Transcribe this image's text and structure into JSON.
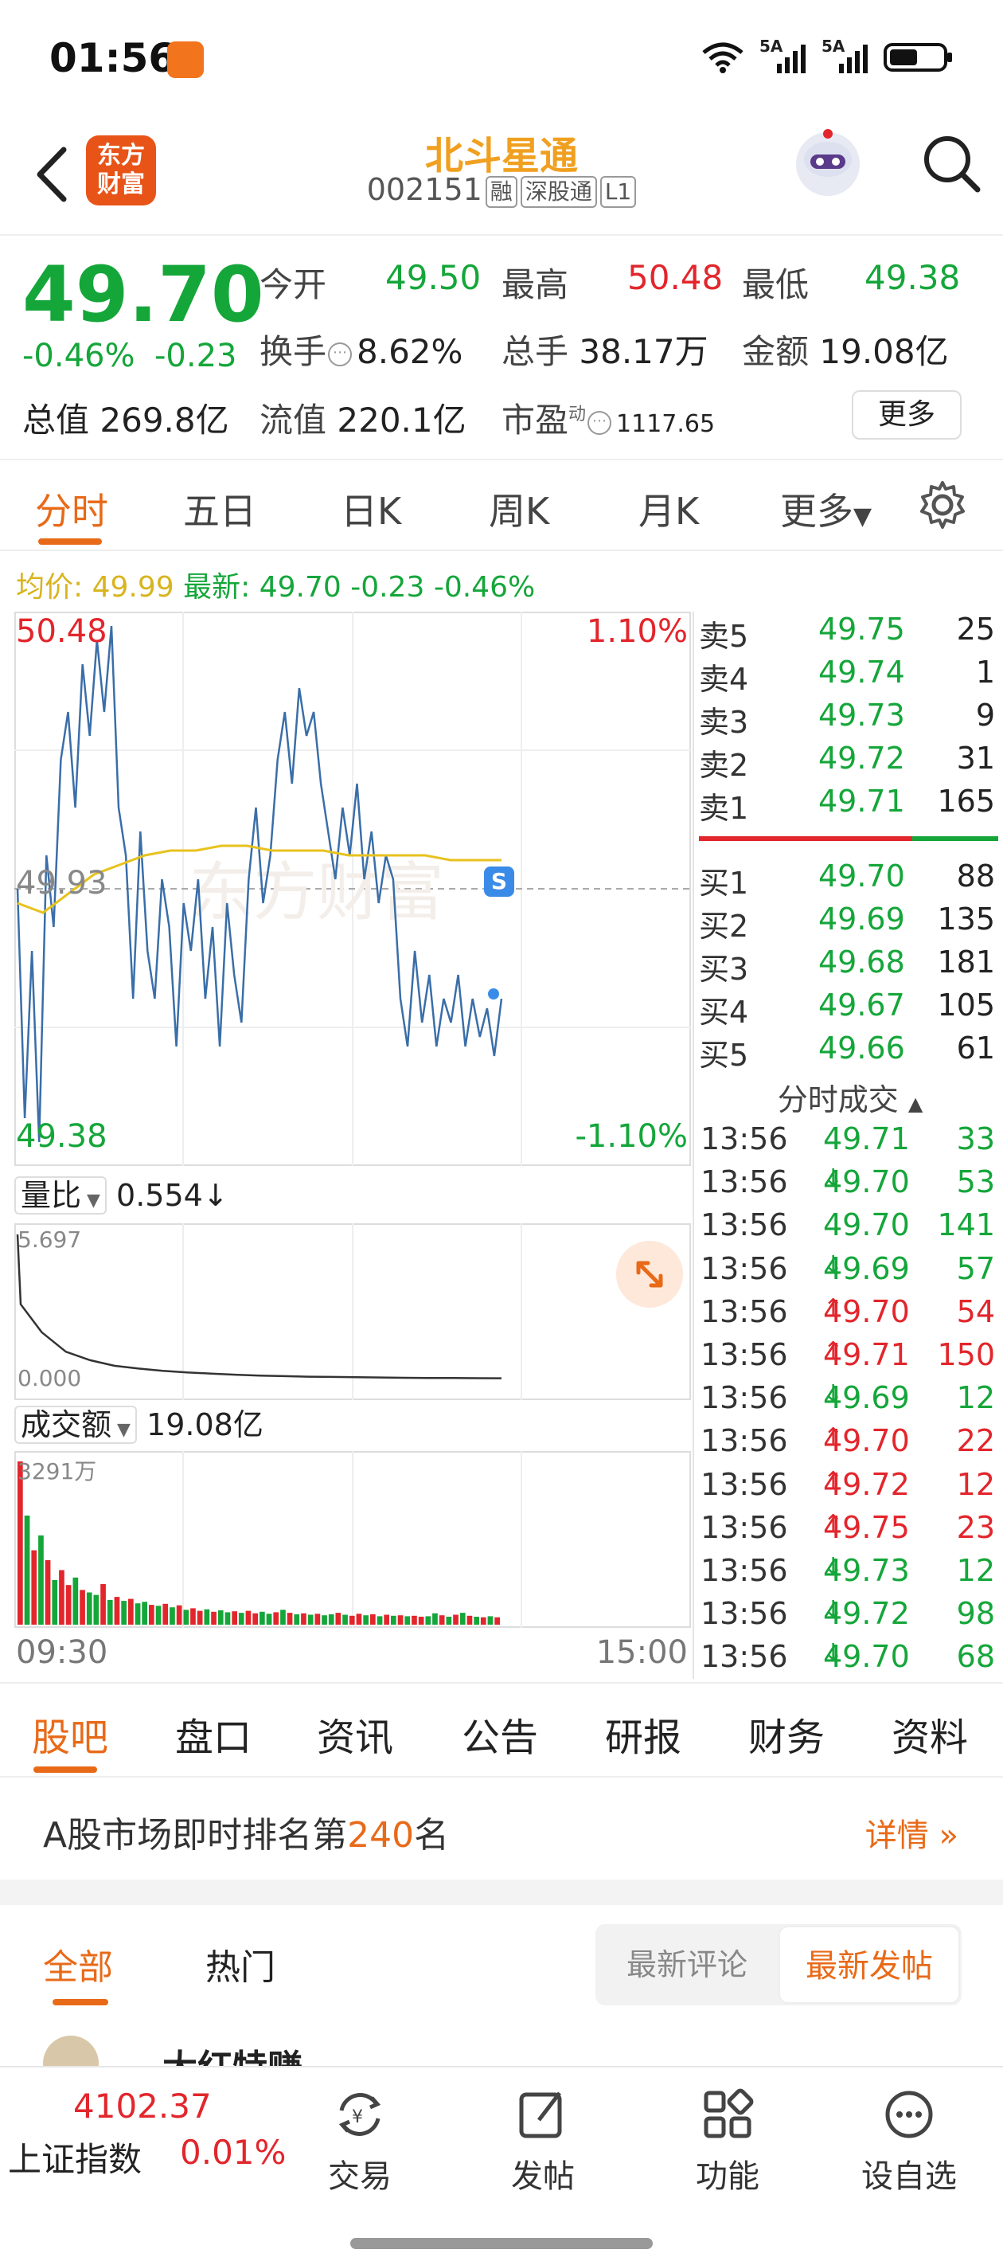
{
  "status_bar": {
    "time": "01:56",
    "net1": "5A",
    "net2": "5A"
  },
  "header": {
    "logo_line1": "东方",
    "logo_line2": "财富",
    "stock_name": "北斗星通",
    "stock_code": "002151",
    "tags": [
      "融",
      "深股通",
      "L1"
    ]
  },
  "quote": {
    "price": "49.70",
    "change_pct": "-0.46%",
    "change": "-0.23",
    "open_label": "今开",
    "open": "49.50",
    "high_label": "最高",
    "high": "50.48",
    "low_label": "最低",
    "low": "49.38",
    "turnover_label": "换手",
    "turnover": "8.62%",
    "volume_label": "总手",
    "volume": "38.17万",
    "amount_label": "金额",
    "amount": "19.08亿",
    "mktcap_label": "总值",
    "mktcap": "269.8亿",
    "float_label": "流值",
    "float": "220.1亿",
    "pe_label": "市盈",
    "pe_sup": "动",
    "pe": "1117.65",
    "more_button": "更多"
  },
  "chart_tabs": [
    "分时",
    "五日",
    "日K",
    "周K",
    "月K",
    "更多"
  ],
  "avg_line": {
    "avg_label": "均价:",
    "avg": "49.99",
    "latest_label": "最新:",
    "latest": "49.70",
    "chg": "-0.23",
    "pct": "-0.46%"
  },
  "chart": {
    "price_top": "50.48",
    "price_bottom": "49.38",
    "price_mid": "49.93",
    "pct_top": "1.10%",
    "pct_bottom": "-1.10%",
    "s_marker": "S",
    "watermark": "东方财富",
    "volume_ratio_label": "量比",
    "volume_ratio": "0.554↓",
    "vr_max": "5.697",
    "vr_min": "0.000",
    "amount_label": "成交额",
    "amount": "19.08亿",
    "amount_max": "3291万",
    "time_start": "09:30",
    "time_end": "15:00"
  },
  "chart_data": {
    "type": "line",
    "title": "",
    "xlabel": "",
    "ylabel": "",
    "x_range": [
      "09:30",
      "15:00"
    ],
    "ylim": [
      49.38,
      50.48
    ],
    "prev_close": 49.93,
    "series": [
      {
        "name": "",
        "color": "#3a6ea8",
        "values": [
          49.93,
          49.45,
          49.8,
          49.4,
          50.0,
          49.85,
          50.2,
          50.3,
          50.1,
          50.4,
          50.25,
          50.45,
          50.3,
          50.48,
          50.1,
          50.0,
          49.7,
          50.05,
          49.8,
          49.7,
          49.95,
          49.85,
          49.6,
          49.9,
          49.8,
          49.95,
          49.7,
          49.85,
          49.6,
          49.9,
          49.75,
          49.65,
          49.95,
          50.1,
          49.9,
          50.0,
          50.2,
          50.3,
          50.15,
          50.35,
          50.25,
          50.3,
          50.15,
          50.05,
          49.95,
          50.1,
          50.0,
          50.15,
          49.95,
          50.05,
          49.9,
          50.0,
          49.95,
          49.7,
          49.6,
          49.8,
          49.65,
          49.75,
          49.6,
          49.7,
          49.65,
          49.75,
          49.6,
          49.7,
          49.62,
          49.68,
          49.58,
          49.7
        ]
      },
      {
        "name": "均价",
        "color": "#e8c21e",
        "values": [
          49.9,
          49.88,
          49.92,
          49.96,
          49.98,
          50.0,
          50.01,
          50.01,
          50.02,
          50.02,
          50.01,
          50.01,
          50.01,
          50.0,
          50.0,
          50.0,
          50.0,
          49.99,
          49.99,
          49.99
        ]
      }
    ],
    "volume_ratio": {
      "ylim": [
        0,
        5.697
      ],
      "values": [
        5.697,
        2.2,
        1.5,
        1.2,
        1.0,
        0.9,
        0.82,
        0.76,
        0.72,
        0.68,
        0.65,
        0.63,
        0.61,
        0.6,
        0.59,
        0.58,
        0.57,
        0.565,
        0.56,
        0.555,
        0.554
      ]
    },
    "amount_bars": {
      "ylim": [
        0,
        3291
      ],
      "values": [
        3291,
        2200,
        1500,
        1800,
        1300,
        900,
        1100,
        800,
        950,
        700,
        650,
        600,
        820,
        500,
        560,
        480,
        520,
        430,
        460,
        400,
        380,
        420,
        350,
        390,
        300,
        330,
        280,
        310,
        260,
        290,
        250,
        270,
        240,
        280,
        230,
        260,
        220,
        250,
        300,
        240,
        210,
        230,
        200,
        220,
        190,
        210,
        240,
        200,
        180,
        220,
        190,
        210,
        170,
        200,
        180,
        190,
        170,
        180,
        160,
        170,
        230,
        190,
        160,
        200,
        240,
        180,
        160,
        150,
        170,
        150
      ],
      "colors": [
        "r",
        "g",
        "r",
        "g",
        "r",
        "g",
        "r",
        "r",
        "g",
        "r",
        "g",
        "g",
        "r",
        "g",
        "r",
        "g",
        "r",
        "g",
        "g",
        "r",
        "g",
        "r",
        "g",
        "r",
        "g",
        "r",
        "r",
        "g",
        "r",
        "g",
        "g",
        "r",
        "g",
        "r",
        "r",
        "g",
        "g",
        "r",
        "g",
        "r",
        "g",
        "r",
        "g",
        "r",
        "g",
        "g",
        "r",
        "g",
        "r",
        "r",
        "g",
        "r",
        "g",
        "r",
        "g",
        "r",
        "g",
        "r",
        "r",
        "g",
        "g",
        "r",
        "g",
        "r",
        "g",
        "r",
        "g",
        "r",
        "g",
        "r"
      ]
    }
  },
  "orderbook": {
    "asks": [
      {
        "label": "卖5",
        "price": "49.75",
        "qty": "25"
      },
      {
        "label": "卖4",
        "price": "49.74",
        "qty": "1"
      },
      {
        "label": "卖3",
        "price": "49.73",
        "qty": "9"
      },
      {
        "label": "卖2",
        "price": "49.72",
        "qty": "31"
      },
      {
        "label": "卖1",
        "price": "49.71",
        "qty": "165"
      }
    ],
    "bids": [
      {
        "label": "买1",
        "price": "49.70",
        "qty": "88"
      },
      {
        "label": "买2",
        "price": "49.69",
        "qty": "135"
      },
      {
        "label": "买3",
        "price": "49.68",
        "qty": "181"
      },
      {
        "label": "买4",
        "price": "49.67",
        "qty": "105"
      },
      {
        "label": "买5",
        "price": "49.66",
        "qty": "61"
      }
    ]
  },
  "trades_title": "分时成交",
  "trades": [
    {
      "time": "13:56",
      "price": "49.71",
      "dir": "",
      "qty": "33",
      "color": "green"
    },
    {
      "time": "13:56",
      "price": "49.70",
      "dir": "↓",
      "qty": "53",
      "color": "green"
    },
    {
      "time": "13:56",
      "price": "49.70",
      "dir": "",
      "qty": "141",
      "color": "green"
    },
    {
      "time": "13:56",
      "price": "49.69",
      "dir": "↓",
      "qty": "57",
      "color": "green"
    },
    {
      "time": "13:56",
      "price": "49.70",
      "dir": "↑",
      "qty": "54",
      "color": "red"
    },
    {
      "time": "13:56",
      "price": "49.71",
      "dir": "↑",
      "qty": "150",
      "color": "red"
    },
    {
      "time": "13:56",
      "price": "49.69",
      "dir": "↓",
      "qty": "12",
      "color": "green"
    },
    {
      "time": "13:56",
      "price": "49.70",
      "dir": "↑",
      "qty": "22",
      "color": "red"
    },
    {
      "time": "13:56",
      "price": "49.72",
      "dir": "↑",
      "qty": "12",
      "color": "red"
    },
    {
      "time": "13:56",
      "price": "49.75",
      "dir": "↑",
      "qty": "23",
      "color": "red"
    },
    {
      "time": "13:56",
      "price": "49.73",
      "dir": "↓",
      "qty": "12",
      "color": "green"
    },
    {
      "time": "13:56",
      "price": "49.72",
      "dir": "↓",
      "qty": "98",
      "color": "green"
    },
    {
      "time": "13:56",
      "price": "49.70",
      "dir": "↓",
      "qty": "68",
      "color": "green"
    }
  ],
  "info_tabs": [
    "股吧",
    "盘口",
    "资讯",
    "公告",
    "研报",
    "财务",
    "资料"
  ],
  "rank": {
    "prefix": "A股市场即时排名第",
    "num": "240",
    "suffix": "名",
    "detail": "详情"
  },
  "post_tabs": {
    "all": "全部",
    "hot": "热门",
    "sort_comment": "最新评论",
    "sort_post": "最新发帖"
  },
  "peek_text": "大红特赚",
  "bottom_nav": {
    "index_value": "4102.37",
    "index_name": "上证指数",
    "index_pct": "0.01%",
    "items": [
      {
        "label": "交易",
        "icon": "trade-icon"
      },
      {
        "label": "发帖",
        "icon": "post-icon"
      },
      {
        "label": "功能",
        "icon": "function-icon"
      },
      {
        "label": "设自选",
        "icon": "watchlist-icon"
      }
    ]
  },
  "colors": {
    "accent": "#e86a18",
    "up": "#e2262c",
    "down": "#15a63a",
    "price_line": "#3a6ea8",
    "avg_line": "#e8c21e"
  }
}
